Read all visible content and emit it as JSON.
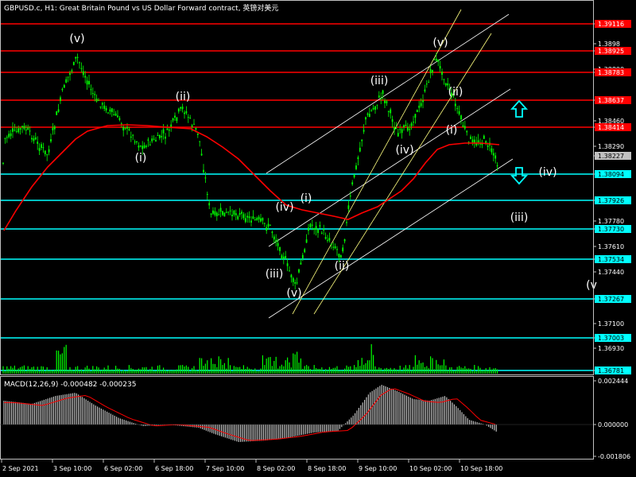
{
  "header": {
    "title": "GBPUSD.c, H1:  Great Britain Pound vs US Dollar Forward contract, 英镑对美元"
  },
  "price_axis": {
    "ticks": [
      {
        "value": 1.3911,
        "label": "1.39116",
        "bg": "#ff0000",
        "fg": "#ffffff"
      },
      {
        "value": 1.3898,
        "label": "1.3898"
      },
      {
        "value": 1.3892,
        "label": "1.38925",
        "bg": "#ff0000",
        "fg": "#ffffff"
      },
      {
        "value": 1.388,
        "label": "1.38800"
      },
      {
        "value": 1.3876,
        "label": "1.38783",
        "bg": "#ff0000",
        "fg": "#ffffff"
      },
      {
        "value": 1.3863,
        "label": "1.38637",
        "bg": "#ff0000",
        "fg": "#ffffff"
      },
      {
        "value": 1.3846,
        "label": "1.38460"
      },
      {
        "value": 1.3841,
        "label": "1.38414",
        "bg": "#ff0000",
        "fg": "#ffffff"
      },
      {
        "value": 1.3829,
        "label": "1.38290"
      },
      {
        "value": 1.3823,
        "label": "1.38227",
        "bg": "#c0c0c0",
        "fg": "#000000"
      },
      {
        "value": 1.3809,
        "label": "1.38094",
        "bg": "#00ffff",
        "fg": "#000000"
      },
      {
        "value": 1.3793,
        "label": "1.37926",
        "bg": "#00ffff",
        "fg": "#000000"
      },
      {
        "value": 1.3778,
        "label": "1.37780"
      },
      {
        "value": 1.3773,
        "label": "1.37730",
        "bg": "#00ffff",
        "fg": "#000000"
      },
      {
        "value": 1.3761,
        "label": "1.37610"
      },
      {
        "value": 1.3753,
        "label": "1.37534",
        "bg": "#00ffff",
        "fg": "#000000"
      },
      {
        "value": 1.3744,
        "label": "1.37440"
      },
      {
        "value": 1.3727,
        "label": "1.37267",
        "bg": "#00ffff",
        "fg": "#000000"
      },
      {
        "value": 1.371,
        "label": "1.37100"
      },
      {
        "value": 1.37,
        "label": "1.37003",
        "bg": "#00ffff",
        "fg": "#000000"
      },
      {
        "value": 1.3693,
        "label": "1.36930"
      },
      {
        "value": 1.3678,
        "label": "1.36781",
        "bg": "#00ffff",
        "fg": "#000000"
      }
    ]
  },
  "macd": {
    "label": "MACD(12,26,9) -0.000482 -0.000235",
    "ticks": [
      "0.002444",
      "0.000000",
      "-0.001806"
    ]
  },
  "time_axis": {
    "labels": [
      "2 Sep 2021",
      "3 Sep 10:00",
      "6 Sep 02:00",
      "6 Sep 18:00",
      "7 Sep 10:00",
      "8 Sep 02:00",
      "8 Sep 18:00",
      "9 Sep 10:00",
      "10 Sep 02:00",
      "10 Sep 18:00"
    ]
  },
  "wave_labels": [
    "(v)",
    "(i)",
    "(ii)",
    "(iii)",
    "(iv)",
    "(i)",
    "(v)",
    "(ii)",
    "(iii)",
    "(iv)",
    "(i)",
    "(v)",
    "(ii)",
    "(iii)",
    "(iv)",
    "(v"
  ],
  "colors": {
    "resistance": "#ff0000",
    "support": "#00ffff",
    "candles": "#00ff00",
    "moving_average": "#ff0000",
    "channel": "#ffffff",
    "channel_alt": "#ffff80",
    "arrow": "#00ffff"
  },
  "icons": {
    "up": "up-arrow-icon",
    "down": "down-arrow-icon"
  }
}
